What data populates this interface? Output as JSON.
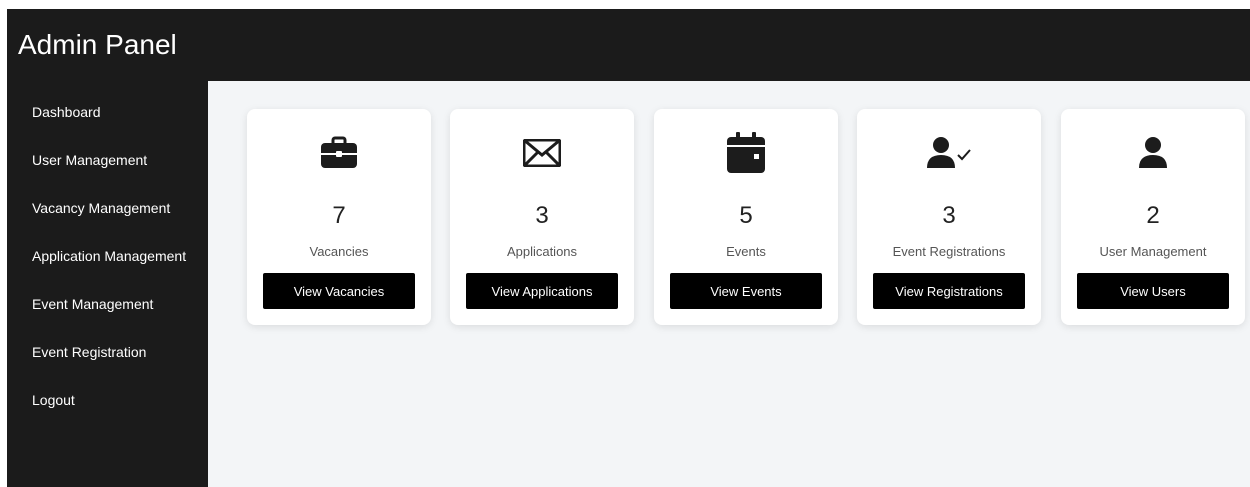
{
  "header": {
    "title": "Admin Panel"
  },
  "sidebar": {
    "items": [
      {
        "label": "Dashboard"
      },
      {
        "label": "User Management"
      },
      {
        "label": "Vacancy Management"
      },
      {
        "label": "Application Management"
      },
      {
        "label": "Event Management"
      },
      {
        "label": "Event Registration"
      },
      {
        "label": "Logout"
      }
    ]
  },
  "cards": [
    {
      "icon": "briefcase-icon",
      "count": "7",
      "label": "Vacancies",
      "button": "View Vacancies"
    },
    {
      "icon": "envelope-icon",
      "count": "3",
      "label": "Applications",
      "button": "View Applications"
    },
    {
      "icon": "calendar-icon",
      "count": "5",
      "label": "Events",
      "button": "View Events"
    },
    {
      "icon": "user-check-icon",
      "count": "3",
      "label": "Event Registrations",
      "button": "View Registrations"
    },
    {
      "icon": "user-icon",
      "count": "2",
      "label": "User Management",
      "button": "View Users"
    }
  ],
  "colors": {
    "topbar": "#1b1b1b",
    "sidebar": "#1b1b1b",
    "content_bg": "#f3f5f7",
    "button": "#000000",
    "icon": "#1c1c1c"
  }
}
